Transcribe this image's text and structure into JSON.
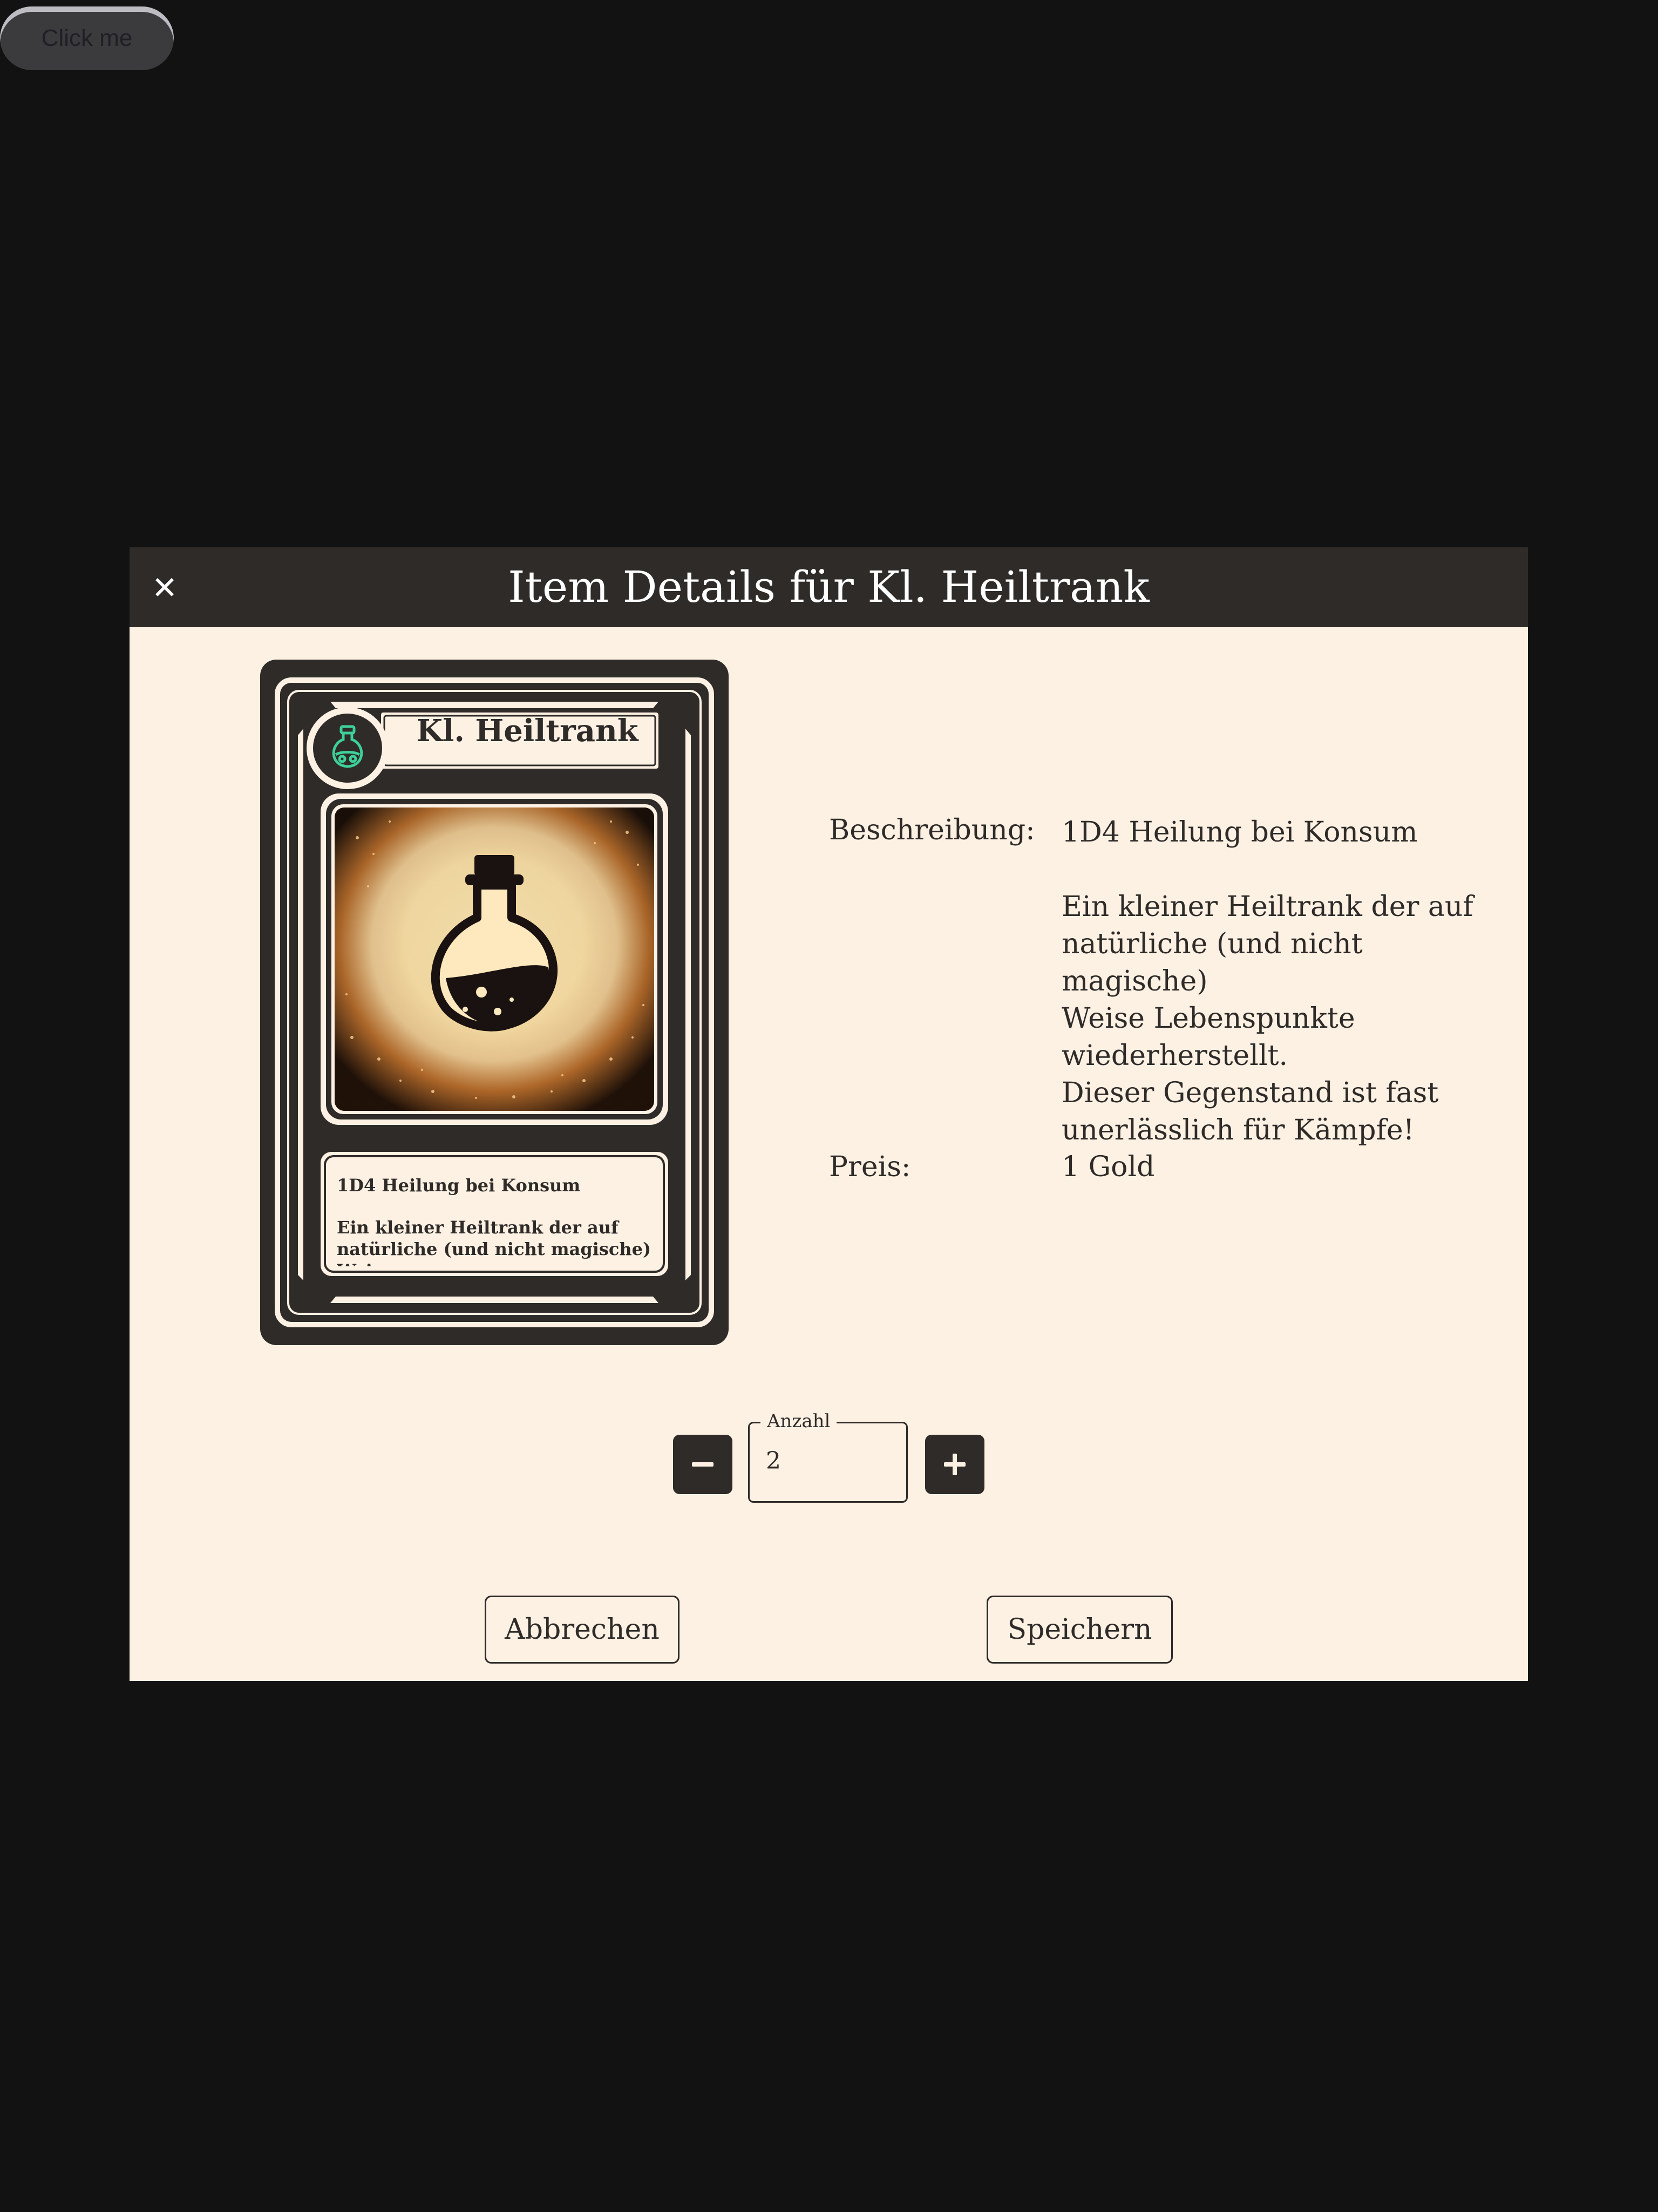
{
  "top_button": {
    "label": "Click me"
  },
  "dialog": {
    "title": "Item Details für Kl. Heiltrank",
    "close_icon": "close-icon",
    "card": {
      "name": "Kl. Heiltrank",
      "emblem_icon": "potion-emblem-icon",
      "artwork": "potion-bottle-illustration",
      "text_line1": "1D4 Heilung bei Konsum",
      "text_line2": "Ein kleiner Heiltrank der auf",
      "text_line3": "natürliche (und nicht magische) Wei..."
    },
    "description": {
      "label": "Beschreibung:",
      "line1": "1D4 Heilung bei Konsum",
      "line2": "Ein kleiner Heiltrank der auf",
      "line3": "natürliche (und nicht magische)",
      "line4": "Weise Lebenspunkte",
      "line5": "wiederherstellt.",
      "line6": "Dieser Gegenstand ist fast",
      "line7": "unerlässlich für Kämpfe!"
    },
    "price": {
      "label": "Preis:",
      "value": "1 Gold"
    },
    "quantity": {
      "legend": "Anzahl",
      "value": "2",
      "minus_icon": "minus-icon",
      "plus_icon": "plus-icon"
    },
    "footer": {
      "cancel_label": "Abbrechen",
      "save_label": "Speichern"
    }
  },
  "colors": {
    "page_background": "#121212",
    "dialog_background": "#fdf1e4",
    "header_background": "#2e2b28",
    "accent_teal": "#3ecf9a",
    "glow": "#fce5b0",
    "ember": "#9a4a12"
  }
}
